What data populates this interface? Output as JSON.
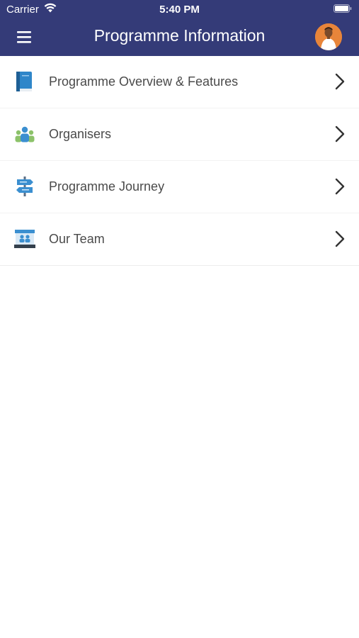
{
  "status_bar": {
    "carrier": "Carrier",
    "time": "5:40 PM"
  },
  "nav": {
    "title": "Programme Information",
    "menu_icon": "hamburger-menu-icon",
    "avatar_icon": "user-avatar"
  },
  "colors": {
    "header_bg": "#343b78",
    "text": "#4a4a4a",
    "chevron": "#333333"
  },
  "menu_items": [
    {
      "label": "Programme Overview & Features",
      "icon": "book-icon"
    },
    {
      "label": "Organisers",
      "icon": "people-group-icon"
    },
    {
      "label": "Programme Journey",
      "icon": "signpost-icon"
    },
    {
      "label": "Our Team",
      "icon": "team-board-icon"
    }
  ]
}
